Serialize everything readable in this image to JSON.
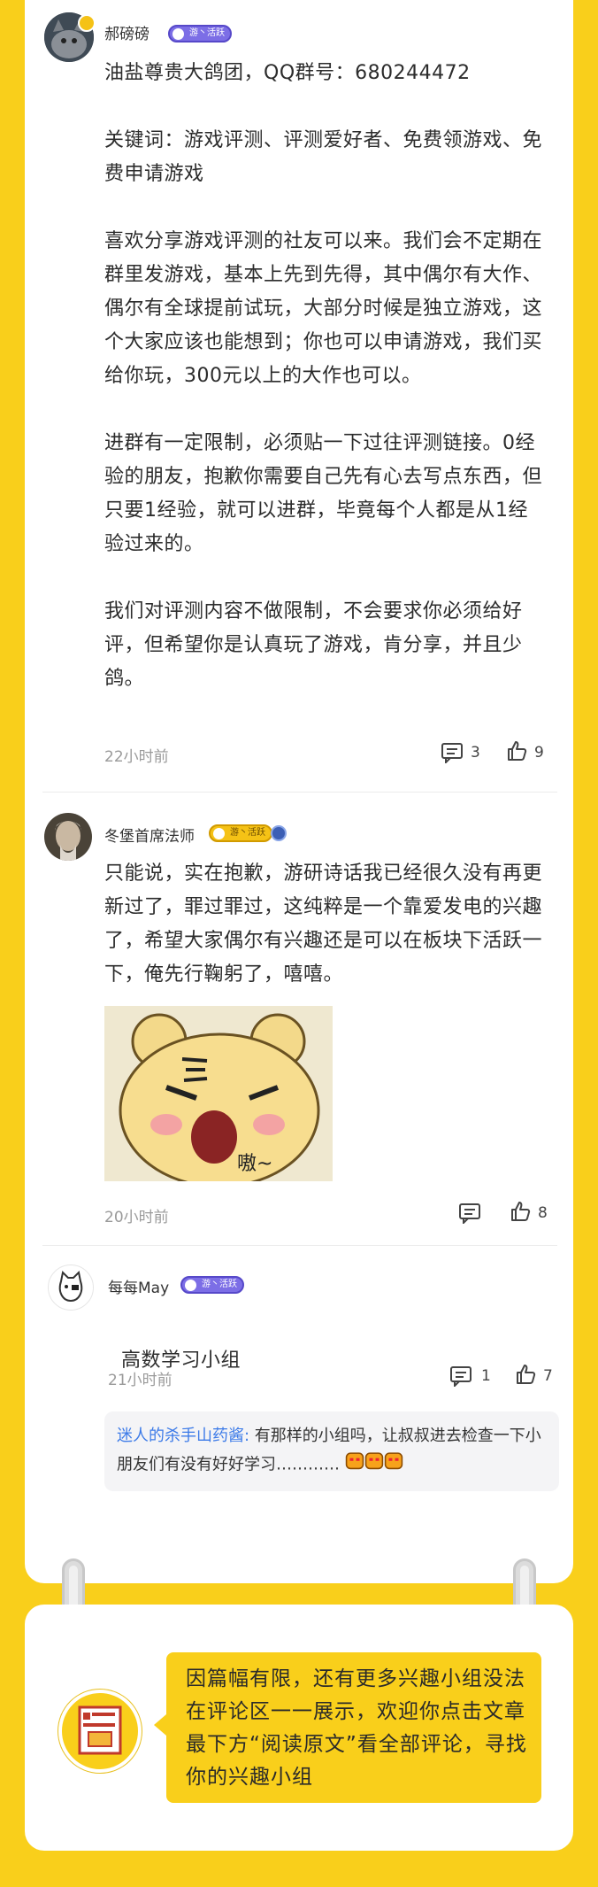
{
  "comments": [
    {
      "username": "郝磅磅",
      "badge": "游丶活跃",
      "text": "油盐尊贵大鸽团，QQ群号：680244472\n\n关键词：游戏评测、评测爱好者、免费领游戏、免费申请游戏\n\n喜欢分享游戏评测的社友可以来。我们会不定期在群里发游戏，基本上先到先得，其中偶尔有大作、偶尔有全球提前试玩，大部分时候是独立游戏，这个大家应该也能想到；你也可以申请游戏，我们买给你玩，300元以上的大作也可以。\n\n进群有一定限制，必须贴一下过往评测链接。0经验的朋友，抱歉你需要自己先有心去写点东西，但只要1经验，就可以进群，毕竟每个人都是从1经验过来的。\n\n我们对评测内容不做限制，不会要求你必须给好评，但希望你是认真玩了游戏，肯分享，并且少鸽。",
      "time": "22小时前",
      "replies": "3",
      "likes": "9"
    },
    {
      "username": "冬堡首席法师",
      "badge": "游丶活跃",
      "text": "只能说，实在抱歉，游研诗话我已经很久没有再更新过了，罪过罪过，这纯粹是一个靠爱发电的兴趣了，希望大家偶尔有兴趣还是可以在板块下活跃一下，俺先行鞠躬了，嘻嘻。",
      "sticker_caption": "嗷~",
      "time": "20小时前",
      "likes": "8"
    },
    {
      "username": "每每May",
      "badge": "游丶活跃",
      "text": "高数学习小组",
      "time": "21小时前",
      "replies": "1",
      "likes": "7",
      "reply": {
        "author": "迷人的杀手山药酱:",
        "text": " 有那样的小组吗，让叔叔进去检查一下小朋友们有没有好好学习…………"
      }
    }
  ],
  "footer_note": "因篇幅有限，还有更多兴趣小组没法在评论区一一展示，欢迎你点击文章最下方“阅读原文”看全部评论，寻找你的兴趣小组",
  "colors": {
    "accent": "#f9cf1b",
    "badge": "#7c6ee6",
    "reply_author": "#3d7be8"
  }
}
